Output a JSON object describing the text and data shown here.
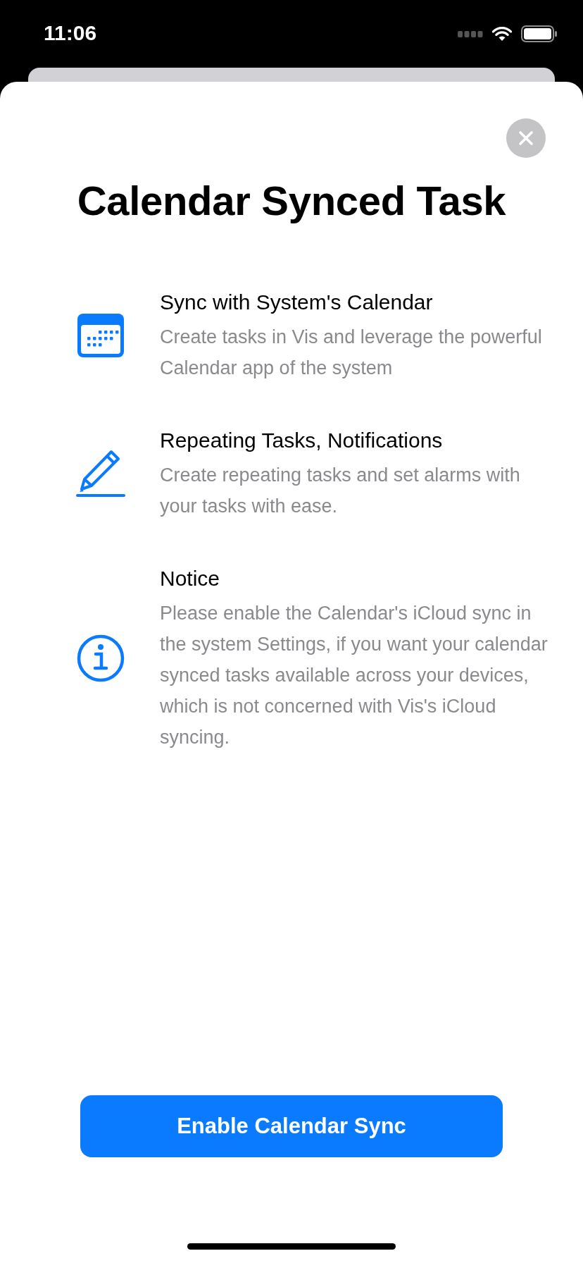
{
  "status_bar": {
    "time": "11:06"
  },
  "title": "Calendar Synced Task",
  "features": [
    {
      "kind": "calendar",
      "heading": "Sync with System's Calendar",
      "description": "Create tasks in Vis and leverage the powerful Calendar app of the system"
    },
    {
      "kind": "pencil",
      "heading": "Repeating Tasks, Notifications",
      "description": "Create repeating tasks and set alarms with your tasks with ease."
    },
    {
      "kind": "info",
      "heading": "Notice",
      "description": "Please enable the Calendar's iCloud sync in the system Settings, if you want your calendar synced tasks available across your devices, which is not concerned with Vis's iCloud syncing."
    }
  ],
  "primary_button": "Enable Calendar Sync"
}
